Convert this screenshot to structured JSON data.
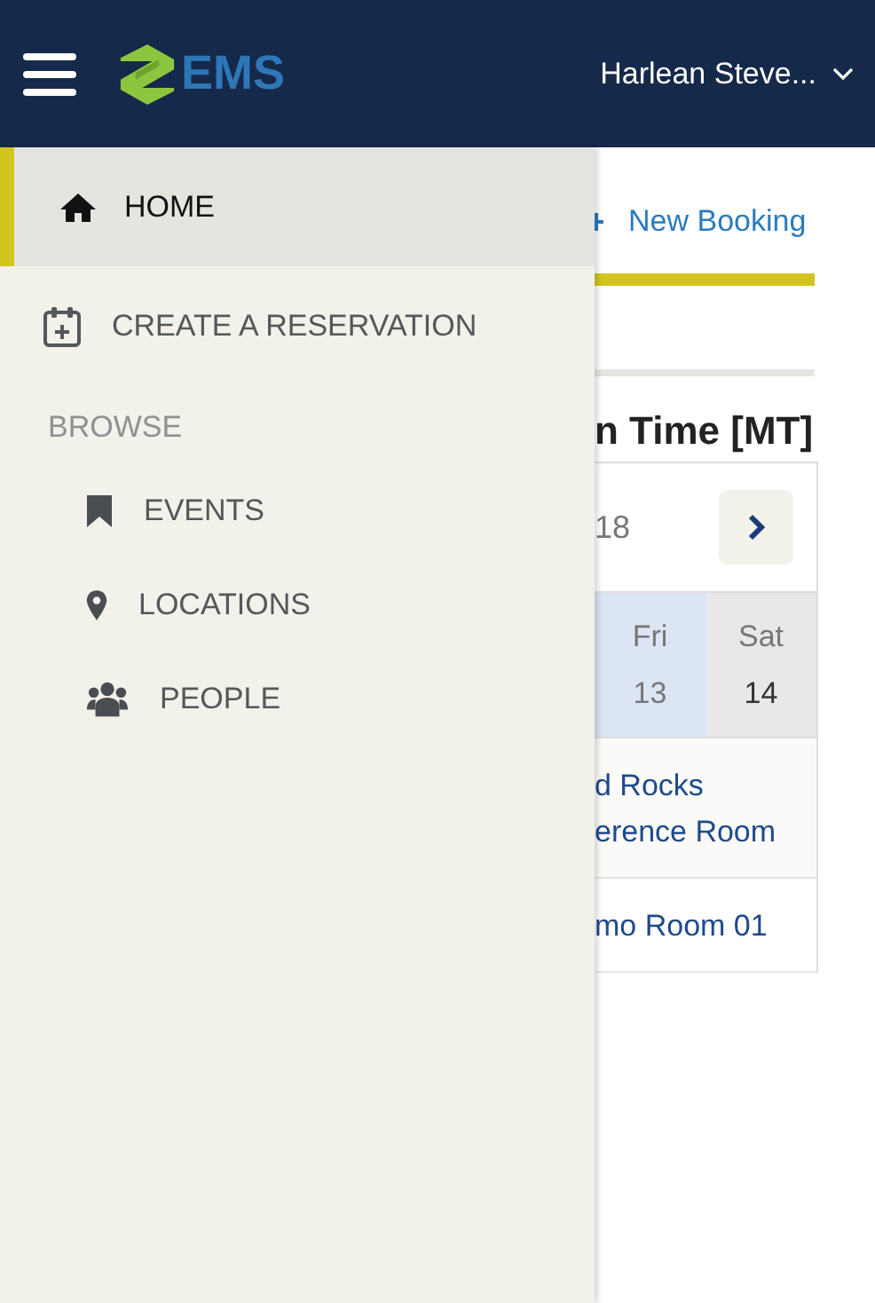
{
  "header": {
    "logo_text": "EMS",
    "user_name": "Harlean Steve..."
  },
  "menu": [
    {
      "kind": "item",
      "label": "HOME",
      "selected": true
    },
    {
      "kind": "item",
      "label": "CREATE A RESERVATION",
      "selected": false
    },
    {
      "kind": "heading",
      "label": "BROWSE"
    },
    {
      "kind": "subitem",
      "label": "EVENTS",
      "selected": false
    },
    {
      "kind": "subitem",
      "label": "LOCATIONS",
      "selected": false
    },
    {
      "kind": "subitem",
      "label": "PEOPLE",
      "selected": false
    }
  ],
  "main": {
    "new_booking": "New Booking",
    "heading": "n Time [MT]",
    "date_fragment": "18",
    "days": [
      {
        "name": "Fri",
        "date": "13",
        "selected": true
      },
      {
        "name": "Sat",
        "date": "14",
        "selected": false
      }
    ],
    "rooms": [
      {
        "lines": [
          "d Rocks",
          "erence Room"
        ]
      },
      {
        "lines": [
          "mo Room 01"
        ]
      }
    ]
  }
}
